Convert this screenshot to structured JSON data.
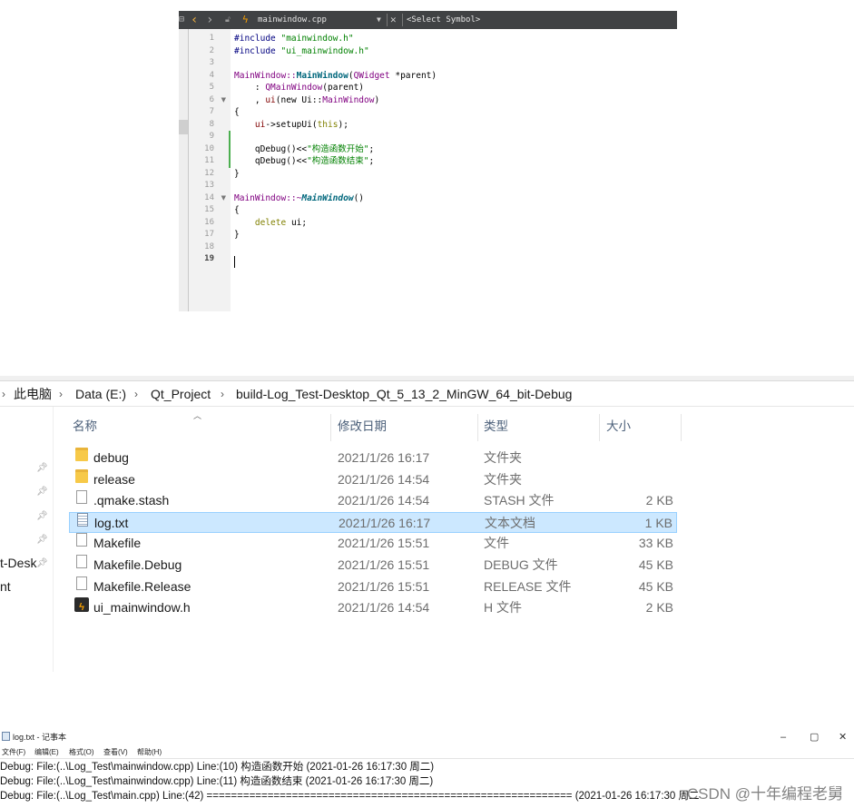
{
  "editor": {
    "filename": "mainwindow.cpp",
    "symbol_placeholder": "<Select Symbol>",
    "lines": [
      {
        "num": "1"
      },
      {
        "num": "2"
      },
      {
        "num": "3"
      },
      {
        "num": "4"
      },
      {
        "num": "5"
      },
      {
        "num": "6"
      },
      {
        "num": "7"
      },
      {
        "num": "8"
      },
      {
        "num": "9"
      },
      {
        "num": "10"
      },
      {
        "num": "11"
      },
      {
        "num": "12"
      },
      {
        "num": "13"
      },
      {
        "num": "14"
      },
      {
        "num": "15"
      },
      {
        "num": "16"
      },
      {
        "num": "17"
      },
      {
        "num": "18"
      },
      {
        "num": "19"
      }
    ],
    "code": {
      "l1_kw": "#include ",
      "l1_str": "\"mainwindow.h\"",
      "l2_kw": "#include ",
      "l2_str": "\"ui_mainwindow.h\"",
      "l4_a": "MainWindow::",
      "l4_b": "MainWindow",
      "l4_c": "(",
      "l4_d": "QWidget",
      "l4_e": " *parent)",
      "l5_a": "    : ",
      "l5_b": "QMainWindow",
      "l5_c": "(parent)",
      "l6_a": "    , ",
      "l6_b": "ui",
      "l6_c": "(new Ui::",
      "l6_d": "MainWindow",
      "l6_e": ")",
      "l7": "{",
      "l8_a": "    ",
      "l8_b": "ui",
      "l8_c": "->",
      "l8_d": "setupUi",
      "l8_e": "(",
      "l8_f": "this",
      "l8_g": ");",
      "l10_a": "    qDebug()<<",
      "l10_b": "\"构造函数开始\"",
      "l10_c": ";",
      "l11_a": "    qDebug()<<",
      "l11_b": "\"构造函数结束\"",
      "l11_c": ";",
      "l12": "}",
      "l14_a": "MainWindow::~",
      "l14_b": "MainWindow",
      "l14_c": "()",
      "l15": "{",
      "l16_a": "    ",
      "l16_b": "delete",
      "l16_c": " ui;",
      "l17": "}"
    }
  },
  "explorer": {
    "breadcrumb": [
      "此电脑",
      "Data (E:)",
      "Qt_Project",
      "build-Log_Test-Desktop_Qt_5_13_2_MinGW_64_bit-Debug"
    ],
    "nav": {
      "item1": "t-Desk",
      "item2": "nt"
    },
    "columns": {
      "name": "名称",
      "date": "修改日期",
      "type": "类型",
      "size": "大小"
    },
    "files": [
      {
        "name": "debug",
        "date": "2021/1/26 16:17",
        "type": "文件夹",
        "size": "",
        "icon": "folder-icon"
      },
      {
        "name": "release",
        "date": "2021/1/26 14:54",
        "type": "文件夹",
        "size": "",
        "icon": "folder-icon"
      },
      {
        "name": ".qmake.stash",
        "date": "2021/1/26 14:54",
        "type": "STASH 文件",
        "size": "2 KB",
        "icon": "file-icon"
      },
      {
        "name": "log.txt",
        "date": "2021/1/26 16:17",
        "type": "文本文档",
        "size": "1 KB",
        "icon": "text-file-icon"
      },
      {
        "name": "Makefile",
        "date": "2021/1/26 15:51",
        "type": "文件",
        "size": "33 KB",
        "icon": "file-icon"
      },
      {
        "name": "Makefile.Debug",
        "date": "2021/1/26 15:51",
        "type": "DEBUG 文件",
        "size": "45 KB",
        "icon": "file-icon"
      },
      {
        "name": "Makefile.Release",
        "date": "2021/1/26 15:51",
        "type": "RELEASE 文件",
        "size": "45 KB",
        "icon": "file-icon"
      },
      {
        "name": "ui_mainwindow.h",
        "date": "2021/1/26 14:54",
        "type": "H 文件",
        "size": "2 KB",
        "icon": "header-file-icon"
      }
    ]
  },
  "notepad": {
    "title": "log.txt - 记事本",
    "menu": [
      "文件(F)",
      "编辑(E)",
      "格式(O)",
      "查看(V)",
      "帮助(H)"
    ],
    "lines": [
      "Debug: File:(..\\Log_Test\\mainwindow.cpp) Line:(10) 构造函数开始 (2021-01-26 16:17:30 周二)",
      "Debug: File:(..\\Log_Test\\mainwindow.cpp) Line:(11) 构造函数结束 (2021-01-26 16:17:30 周二)",
      "Debug: File:(..\\Log_Test\\main.cpp) Line:(42) ============================================================ (2021-01-26 16:17:30 周二"
    ],
    "watermark": "CSDN @十年编程老舅"
  }
}
